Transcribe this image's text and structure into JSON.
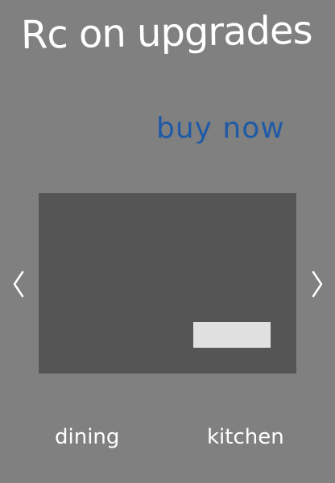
{
  "header": {
    "title": "Rc on upgrades"
  },
  "promo": {
    "buy_now_label": "buy now"
  },
  "carousel": {
    "prev_icon": "chevron-left-icon",
    "next_icon": "chevron-right-icon",
    "cta_label": ""
  },
  "categories": [
    {
      "label": "dining"
    },
    {
      "label": "kitchen"
    }
  ],
  "colors": {
    "background": "#808080",
    "panel": "#555555",
    "cta": "#e0e0e0",
    "link": "#1f5aa6",
    "text": "#ffffff"
  }
}
